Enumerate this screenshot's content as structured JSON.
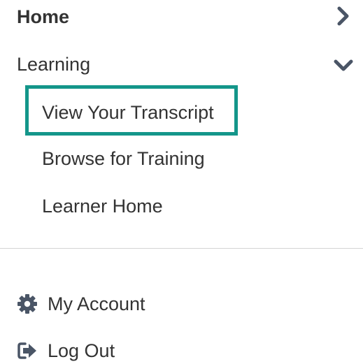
{
  "nav": {
    "home": {
      "label": "Home",
      "icon": "chevron-right-icon"
    },
    "learning": {
      "label": "Learning",
      "icon": "chevron-down-icon",
      "expanded": true,
      "items": [
        {
          "label": "View Your Transcript",
          "focused": true
        },
        {
          "label": "Browse for Training"
        },
        {
          "label": "Learner Home"
        }
      ]
    }
  },
  "account": {
    "my_account": {
      "label": "My Account",
      "icon": "gear-icon"
    },
    "log_out": {
      "label": "Log Out",
      "icon": "sign-out-icon"
    }
  },
  "colors": {
    "text": "#333333",
    "icon": "#4a5566",
    "focus_border": "#14968a",
    "divider": "#d4d4d4"
  }
}
